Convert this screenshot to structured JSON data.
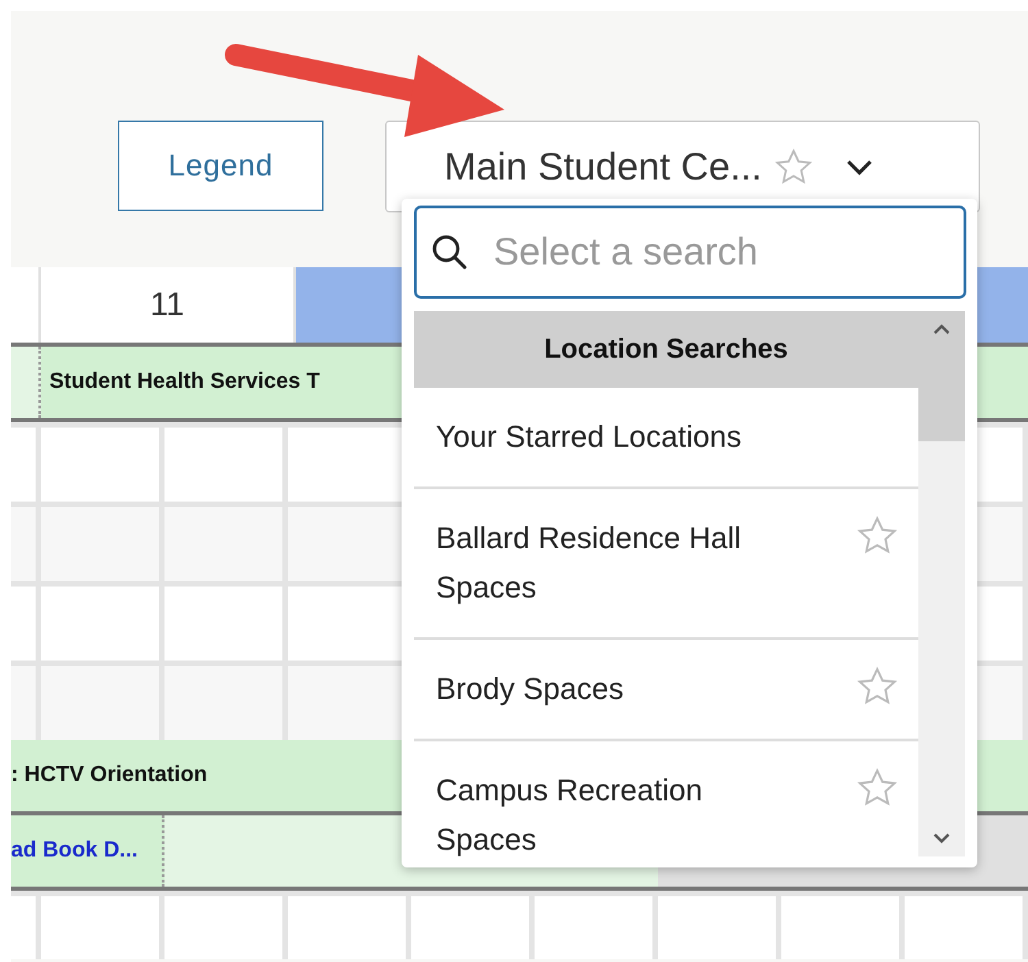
{
  "toolbar": {
    "legend_button": "Legend",
    "location_select": {
      "value": "Main Student Ce...",
      "starred": false
    }
  },
  "calendar": {
    "day_columns": [
      {
        "label": "11",
        "selected": false
      },
      {
        "selected": true
      }
    ],
    "rows": [
      {
        "kind": "event",
        "text": "Student Health Services T"
      },
      {
        "kind": "grid"
      },
      {
        "kind": "grid"
      },
      {
        "kind": "grid"
      },
      {
        "kind": "grid"
      },
      {
        "kind": "event",
        "text": ": HCTV Orientation"
      },
      {
        "kind": "link_event",
        "text": "ad Book D..."
      },
      {
        "kind": "grid"
      }
    ]
  },
  "dropdown": {
    "search": {
      "placeholder": "Select a search"
    },
    "header": "Location Searches",
    "items": [
      {
        "label": "Your Starred Locations",
        "kind": "group"
      },
      {
        "label": "Ballard Residence Hall Spaces",
        "kind": "location",
        "starred": false
      },
      {
        "label": "Brody Spaces",
        "kind": "location",
        "starred": false
      },
      {
        "label": "Campus Recreation Spaces",
        "kind": "location",
        "starred": false
      }
    ]
  }
}
